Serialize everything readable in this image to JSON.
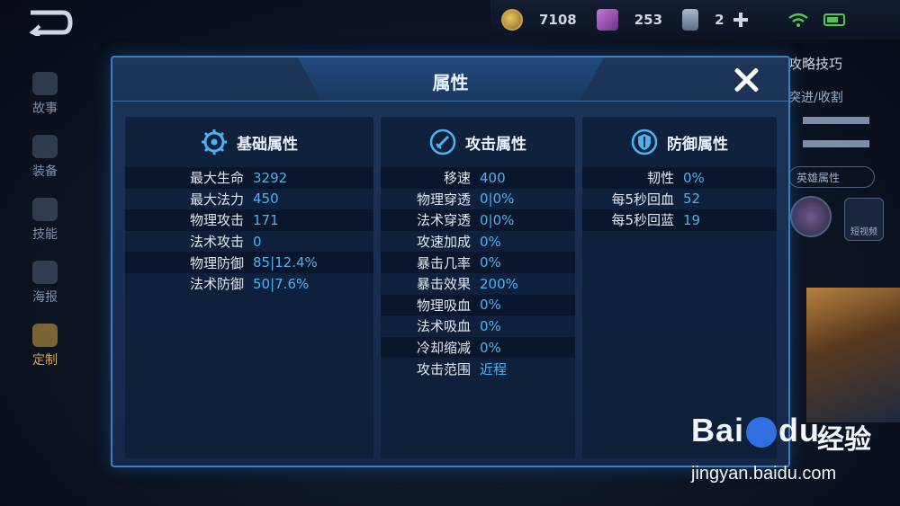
{
  "top_bar": {
    "gold": "7108",
    "diamonds": "253",
    "cards": "2"
  },
  "left_nav": [
    {
      "label": "故事",
      "icon": "book-icon"
    },
    {
      "label": "装备",
      "icon": "armor-icon"
    },
    {
      "label": "技能",
      "icon": "skill-icon"
    },
    {
      "label": "海报",
      "icon": "poster-icon"
    },
    {
      "label": "定制",
      "icon": "customize-icon",
      "active": true
    }
  ],
  "right_panel": {
    "title": "攻略技巧",
    "line1": "突进/收割",
    "hero_attr_btn": "英雄属性",
    "video_label": "短视频"
  },
  "dialog": {
    "title": "属性",
    "columns": [
      {
        "title": "基础属性",
        "icon": "gear-icon",
        "rows": [
          {
            "label": "最大生命",
            "value": "3292"
          },
          {
            "label": "最大法力",
            "value": "450"
          },
          {
            "label": "物理攻击",
            "value": "171"
          },
          {
            "label": "法术攻击",
            "value": "0"
          },
          {
            "label": "物理防御",
            "value": "85|12.4%"
          },
          {
            "label": "法术防御",
            "value": "50|7.6%"
          }
        ]
      },
      {
        "title": "攻击属性",
        "icon": "sword-icon",
        "rows": [
          {
            "label": "移速",
            "value": "400"
          },
          {
            "label": "物理穿透",
            "value": "0|0%"
          },
          {
            "label": "法术穿透",
            "value": "0|0%"
          },
          {
            "label": "攻速加成",
            "value": "0%"
          },
          {
            "label": "暴击几率",
            "value": "0%"
          },
          {
            "label": "暴击效果",
            "value": "200%"
          },
          {
            "label": "物理吸血",
            "value": "0%"
          },
          {
            "label": "法术吸血",
            "value": "0%"
          },
          {
            "label": "冷却缩减",
            "value": "0%"
          },
          {
            "label": "攻击范围",
            "value": "近程"
          }
        ]
      },
      {
        "title": "防御属性",
        "icon": "shield-icon",
        "rows": [
          {
            "label": "韧性",
            "value": "0%"
          },
          {
            "label": "每5秒回血",
            "value": "52"
          },
          {
            "label": "每5秒回蓝",
            "value": "19"
          }
        ]
      }
    ]
  },
  "watermark": {
    "brand": "Bai",
    "brand_tail": "du",
    "cn": "经验",
    "url": "jingyan.baidu.com"
  },
  "colors": {
    "value_blue": "#4ab2f5",
    "dialog_border": "#3c7fc2",
    "active_nav": "#d9a544"
  }
}
